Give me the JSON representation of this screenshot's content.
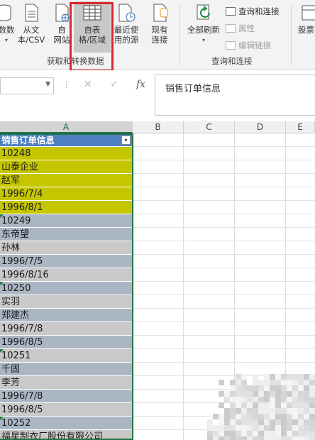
{
  "ribbon": {
    "buttons": {
      "from_db": {
        "line1": "数数",
        "caret": "▾"
      },
      "from_csv": {
        "line1": "从文",
        "line2": "本/CSV"
      },
      "from_web": {
        "line1": "自",
        "line2": "网站"
      },
      "from_table": {
        "line1": "自表",
        "line2": "格/区域"
      },
      "recent_sources": {
        "line1": "最近使",
        "line2": "用的源"
      },
      "existing_conn": {
        "line1": "现有",
        "line2": "连接"
      },
      "refresh_all": {
        "line1": "全部刷新",
        "caret": "▾"
      },
      "stock": {
        "line1": "股票"
      }
    },
    "small": {
      "queries_connections": "查询和连接",
      "properties": "属性",
      "edit_links": "编辑链接"
    },
    "groups": {
      "get_transform": "获取和转换数据",
      "queries_connections": "查询和连接"
    }
  },
  "formula_bar": {
    "dots": "⋮",
    "cancel": "✕",
    "enter": "✓",
    "fx": "fx",
    "content": "销售订单信息"
  },
  "grid": {
    "columns": [
      "A",
      "B",
      "C",
      "D",
      "E"
    ],
    "header_cell": "销售订单信息",
    "filter_glyph": "▾",
    "cells": [
      {
        "text": "10248",
        "fill": "yel",
        "flag": false
      },
      {
        "text": "山泰企业",
        "fill": "yel",
        "flag": false
      },
      {
        "text": "赵军",
        "fill": "yel",
        "flag": false
      },
      {
        "text": "1996/7/4",
        "fill": "yel",
        "flag": false
      },
      {
        "text": "1996/8/1",
        "fill": "yel",
        "flag": false
      },
      {
        "text": "10249",
        "fill": "g1",
        "flag": true
      },
      {
        "text": "东帝望",
        "fill": "g1",
        "flag": false
      },
      {
        "text": "孙林",
        "fill": "g2",
        "flag": false
      },
      {
        "text": "1996/7/5",
        "fill": "g1",
        "flag": false
      },
      {
        "text": "1996/8/16",
        "fill": "g2",
        "flag": false
      },
      {
        "text": "10250",
        "fill": "g1",
        "flag": true
      },
      {
        "text": "实羽",
        "fill": "g2",
        "flag": false
      },
      {
        "text": "郑建杰",
        "fill": "g1",
        "flag": false
      },
      {
        "text": "1996/7/8",
        "fill": "g2",
        "flag": false
      },
      {
        "text": "1996/8/5",
        "fill": "g1",
        "flag": false
      },
      {
        "text": "10251",
        "fill": "g2",
        "flag": true
      },
      {
        "text": "千固",
        "fill": "g1",
        "flag": false
      },
      {
        "text": "李芳",
        "fill": "g2",
        "flag": false
      },
      {
        "text": "1996/7/8",
        "fill": "g1",
        "flag": false
      },
      {
        "text": "1996/8/5",
        "fill": "g2",
        "flag": false
      },
      {
        "text": "10252",
        "fill": "g1",
        "flag": true
      },
      {
        "text": "福星制衣厂股份有限公司",
        "fill": "g2",
        "flag": false
      }
    ]
  },
  "colors": {
    "highlight": "#d9262f",
    "table_header": "#4e7fc1",
    "yellow_fill": "#c6c600",
    "excel_green": "#217346"
  }
}
